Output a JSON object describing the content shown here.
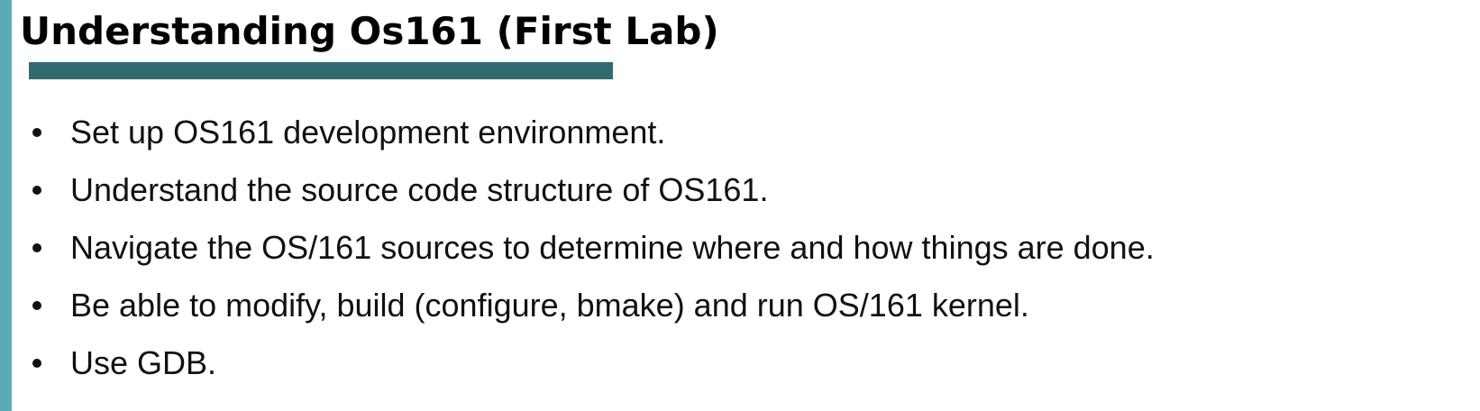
{
  "slide": {
    "title": "Understanding Os161 (First Lab)",
    "bullets": [
      "Set up OS161 development environment.",
      "Understand the source code structure of OS161.",
      "Navigate the OS/161 sources to determine where and how things are done.",
      "Be able to modify, build (configure, bmake) and run OS/161 kernel.",
      "Use GDB."
    ]
  },
  "colors": {
    "accent_bar": "#5aacb2",
    "title_underline": "#316a70",
    "text": "#111111"
  }
}
